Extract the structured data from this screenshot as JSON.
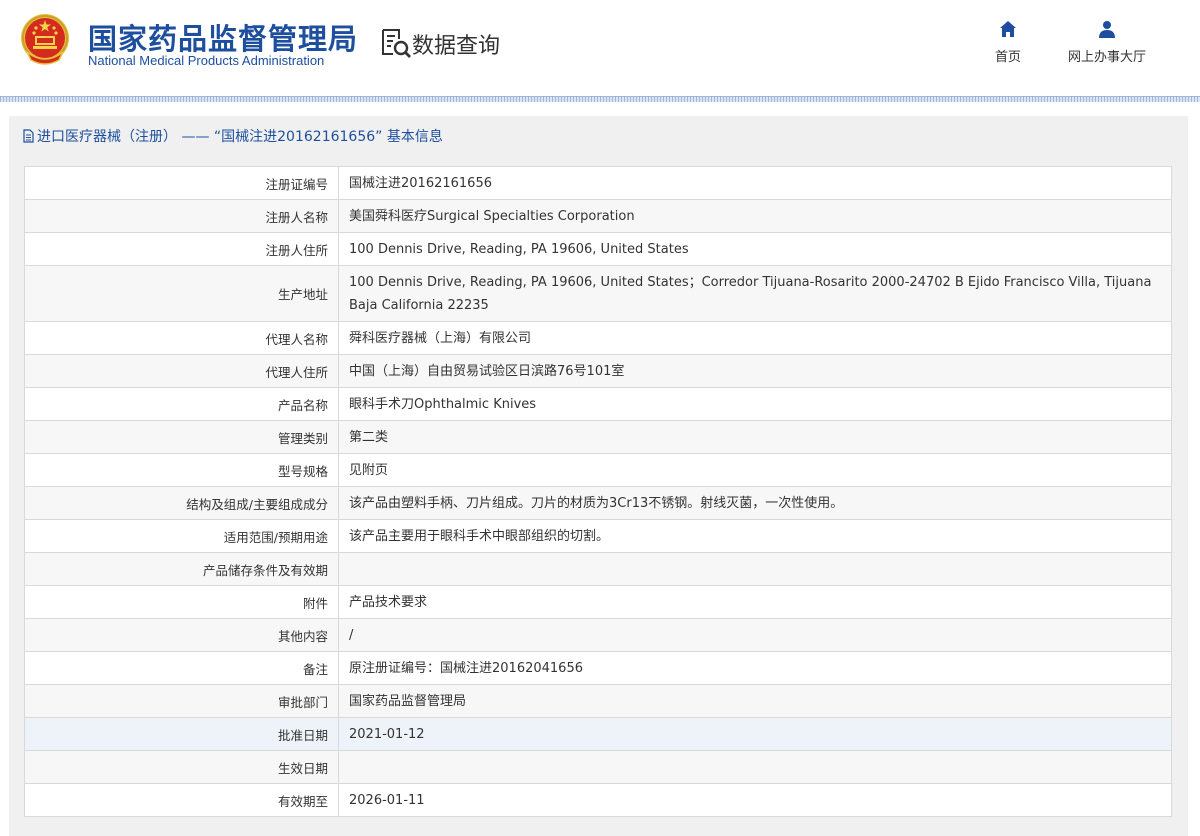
{
  "header": {
    "brand_cn": "国家药品监督管理局",
    "brand_en": "National Medical Products Administration",
    "section_title": "数据查询",
    "nav": [
      {
        "label": "首页",
        "icon": "home-icon"
      },
      {
        "label": "网上办事大厅",
        "icon": "user-icon"
      }
    ]
  },
  "panel": {
    "title": "进口医疗器械（注册） —— “国械注进20162161656” 基本信息"
  },
  "details": [
    {
      "label": "注册证编号",
      "value": "国械注进20162161656"
    },
    {
      "label": "注册人名称",
      "value": "美国舜科医疗Surgical Specialties Corporation"
    },
    {
      "label": "注册人住所",
      "value": "100 Dennis Drive, Reading, PA 19606, United States"
    },
    {
      "label": "生产地址",
      "value": "100 Dennis Drive, Reading, PA 19606, United States；Corredor Tijuana-Rosarito 2000-24702 B Ejido Francisco Villa, Tijuana Baja California 22235"
    },
    {
      "label": "代理人名称",
      "value": "舜科医疗器械（上海）有限公司"
    },
    {
      "label": "代理人住所",
      "value": "中国（上海）自由贸易试验区日滨路76号101室"
    },
    {
      "label": "产品名称",
      "value": "眼科手术刀Ophthalmic Knives"
    },
    {
      "label": "管理类别",
      "value": "第二类"
    },
    {
      "label": "型号规格",
      "value": "见附页"
    },
    {
      "label": "结构及组成/主要组成成分",
      "value": "该产品由塑料手柄、刀片组成。刀片的材质为3Cr13不锈钢。射线灭菌，一次性使用。"
    },
    {
      "label": "适用范围/预期用途",
      "value": "该产品主要用于眼科手术中眼部组织的切割。"
    },
    {
      "label": "产品储存条件及有效期",
      "value": ""
    },
    {
      "label": "附件",
      "value": "产品技术要求"
    },
    {
      "label": "其他内容",
      "value": "/"
    },
    {
      "label": "备注",
      "value": "原注册证编号：国械注进20162041656"
    },
    {
      "label": "审批部门",
      "value": "国家药品监督管理局"
    },
    {
      "label": "批准日期",
      "value": "2021-01-12"
    },
    {
      "label": "生效日期",
      "value": ""
    },
    {
      "label": "有效期至",
      "value": "2026-01-11"
    }
  ]
}
